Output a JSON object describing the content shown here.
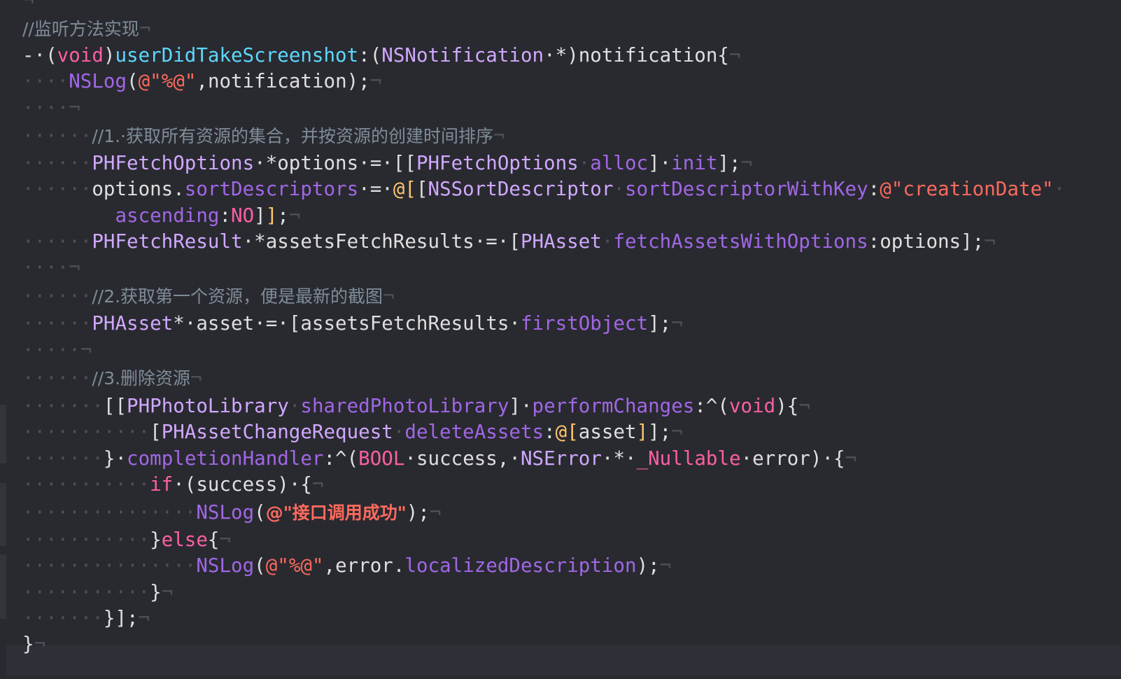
{
  "editor": {
    "lines": [
      {
        "tokens": [
          {
            "t": "¬",
            "c": "ws"
          }
        ]
      },
      {
        "tokens": [
          {
            "t": "//监听方法实现",
            "c": "comment"
          },
          {
            "t": "¬",
            "c": "ws"
          }
        ]
      },
      {
        "tokens": [
          {
            "t": "-·(",
            "c": "plain"
          },
          {
            "t": "void",
            "c": "keyword"
          },
          {
            "t": ")",
            "c": "plain"
          },
          {
            "t": "userDidTakeScreenshot",
            "c": "declname"
          },
          {
            "t": ":(",
            "c": "plain"
          },
          {
            "t": "NSNotification",
            "c": "class"
          },
          {
            "t": "·*)notification{",
            "c": "plain"
          },
          {
            "t": "¬",
            "c": "ws"
          }
        ]
      },
      {
        "tokens": [
          {
            "t": "····",
            "c": "ws"
          },
          {
            "t": "NSLog",
            "c": "method"
          },
          {
            "t": "(",
            "c": "plain"
          },
          {
            "t": "@\"%@\"",
            "c": "string"
          },
          {
            "t": ",notification);",
            "c": "plain"
          },
          {
            "t": "¬",
            "c": "ws"
          }
        ]
      },
      {
        "tokens": [
          {
            "t": "····¬",
            "c": "ws"
          }
        ]
      },
      {
        "tokens": [
          {
            "t": "······",
            "c": "ws"
          },
          {
            "t": "//1.·获取所有资源的集合，并按资源的创建时间排序",
            "c": "comment"
          },
          {
            "t": "¬",
            "c": "ws"
          }
        ]
      },
      {
        "tokens": [
          {
            "t": "······",
            "c": "ws"
          },
          {
            "t": "PHFetchOptions",
            "c": "class"
          },
          {
            "t": "·*options·=·[[",
            "c": "plain"
          },
          {
            "t": "PHFetchOptions",
            "c": "class"
          },
          {
            "t": "·",
            "c": "ws"
          },
          {
            "t": "alloc",
            "c": "method"
          },
          {
            "t": "]·",
            "c": "plain"
          },
          {
            "t": "init",
            "c": "method"
          },
          {
            "t": "];",
            "c": "plain"
          },
          {
            "t": "¬",
            "c": "ws"
          }
        ]
      },
      {
        "tokens": [
          {
            "t": "······",
            "c": "ws"
          },
          {
            "t": "options.",
            "c": "plain"
          },
          {
            "t": "sortDescriptors",
            "c": "method"
          },
          {
            "t": "·=·",
            "c": "plain"
          },
          {
            "t": "@[",
            "c": "gold"
          },
          {
            "t": "[",
            "c": "plain"
          },
          {
            "t": "NSSortDescriptor",
            "c": "class"
          },
          {
            "t": "·",
            "c": "ws"
          },
          {
            "t": "sortDescriptorWithKey",
            "c": "method"
          },
          {
            "t": ":",
            "c": "plain"
          },
          {
            "t": "@\"creationDate\"",
            "c": "string"
          },
          {
            "t": "·",
            "c": "ws"
          }
        ]
      },
      {
        "tokens": [
          {
            "t": "        ",
            "c": "ws"
          },
          {
            "t": "ascending",
            "c": "method"
          },
          {
            "t": ":",
            "c": "plain"
          },
          {
            "t": "NO",
            "c": "keyword"
          },
          {
            "t": "]",
            "c": "plain"
          },
          {
            "t": "]",
            "c": "gold"
          },
          {
            "t": ";",
            "c": "plain"
          },
          {
            "t": "¬",
            "c": "ws"
          }
        ]
      },
      {
        "tokens": [
          {
            "t": "······",
            "c": "ws"
          },
          {
            "t": "PHFetchResult",
            "c": "class"
          },
          {
            "t": "·*assetsFetchResults·=·[",
            "c": "plain"
          },
          {
            "t": "PHAsset",
            "c": "class"
          },
          {
            "t": "·",
            "c": "ws"
          },
          {
            "t": "fetchAssetsWithOptions",
            "c": "method"
          },
          {
            "t": ":options];",
            "c": "plain"
          },
          {
            "t": "¬",
            "c": "ws"
          }
        ]
      },
      {
        "tokens": [
          {
            "t": "····¬",
            "c": "ws"
          }
        ]
      },
      {
        "tokens": [
          {
            "t": "······",
            "c": "ws"
          },
          {
            "t": "//2.获取第一个资源，便是最新的截图",
            "c": "comment"
          },
          {
            "t": "¬",
            "c": "ws"
          }
        ]
      },
      {
        "tokens": [
          {
            "t": "······",
            "c": "ws"
          },
          {
            "t": "PHAsset",
            "c": "class"
          },
          {
            "t": "*·asset·=·[assetsFetchResults·",
            "c": "plain"
          },
          {
            "t": "firstObject",
            "c": "method"
          },
          {
            "t": "];",
            "c": "plain"
          },
          {
            "t": "¬",
            "c": "ws"
          }
        ]
      },
      {
        "tokens": [
          {
            "t": "·····¬",
            "c": "ws"
          }
        ]
      },
      {
        "tokens": [
          {
            "t": "······",
            "c": "ws"
          },
          {
            "t": "//3.删除资源",
            "c": "comment"
          },
          {
            "t": "¬",
            "c": "ws"
          }
        ]
      },
      {
        "tokens": [
          {
            "t": "·······",
            "c": "ws"
          },
          {
            "t": "[[",
            "c": "plain"
          },
          {
            "t": "PHPhotoLibrary",
            "c": "class"
          },
          {
            "t": "·",
            "c": "ws"
          },
          {
            "t": "sharedPhotoLibrary",
            "c": "method"
          },
          {
            "t": "]·",
            "c": "plain"
          },
          {
            "t": "performChanges",
            "c": "method"
          },
          {
            "t": ":^(",
            "c": "plain"
          },
          {
            "t": "void",
            "c": "keyword"
          },
          {
            "t": "){",
            "c": "plain"
          },
          {
            "t": "¬",
            "c": "ws"
          }
        ]
      },
      {
        "tokens": [
          {
            "t": "···········",
            "c": "ws"
          },
          {
            "t": "[",
            "c": "plain"
          },
          {
            "t": "PHAssetChangeRequest",
            "c": "class"
          },
          {
            "t": "·",
            "c": "ws"
          },
          {
            "t": "deleteAssets",
            "c": "method"
          },
          {
            "t": ":",
            "c": "plain"
          },
          {
            "t": "@[",
            "c": "gold"
          },
          {
            "t": "asset",
            "c": "plain"
          },
          {
            "t": "]",
            "c": "gold"
          },
          {
            "t": "];",
            "c": "plain"
          },
          {
            "t": "¬",
            "c": "ws"
          }
        ]
      },
      {
        "tokens": [
          {
            "t": "·······",
            "c": "ws"
          },
          {
            "t": "}·",
            "c": "plain"
          },
          {
            "t": "completionHandler",
            "c": "method"
          },
          {
            "t": ":^(",
            "c": "plain"
          },
          {
            "t": "BOOL",
            "c": "keyword"
          },
          {
            "t": "·success,·",
            "c": "plain"
          },
          {
            "t": "NSError",
            "c": "class"
          },
          {
            "t": "·*·",
            "c": "plain"
          },
          {
            "t": "_Nullable",
            "c": "keyword"
          },
          {
            "t": "·error)·{",
            "c": "plain"
          },
          {
            "t": "¬",
            "c": "ws"
          }
        ]
      },
      {
        "tokens": [
          {
            "t": "···········",
            "c": "ws"
          },
          {
            "t": "if",
            "c": "keyword"
          },
          {
            "t": "·(success)·{",
            "c": "plain"
          },
          {
            "t": "¬",
            "c": "ws"
          }
        ]
      },
      {
        "tokens": [
          {
            "t": "···············",
            "c": "ws"
          },
          {
            "t": "NSLog",
            "c": "method"
          },
          {
            "t": "(",
            "c": "plain"
          },
          {
            "t": "@\"接口调用成功\"",
            "c": "strbold"
          },
          {
            "t": ");",
            "c": "plain"
          },
          {
            "t": "¬",
            "c": "ws"
          }
        ]
      },
      {
        "tokens": [
          {
            "t": "···········",
            "c": "ws"
          },
          {
            "t": "}",
            "c": "plain"
          },
          {
            "t": "else",
            "c": "keyword"
          },
          {
            "t": "{",
            "c": "plain"
          },
          {
            "t": "¬",
            "c": "ws"
          }
        ]
      },
      {
        "tokens": [
          {
            "t": "···············",
            "c": "ws"
          },
          {
            "t": "NSLog",
            "c": "method"
          },
          {
            "t": "(",
            "c": "plain"
          },
          {
            "t": "@\"%@\"",
            "c": "string"
          },
          {
            "t": ",error.",
            "c": "plain"
          },
          {
            "t": "localizedDescription",
            "c": "method"
          },
          {
            "t": ");",
            "c": "plain"
          },
          {
            "t": "¬",
            "c": "ws"
          }
        ]
      },
      {
        "tokens": [
          {
            "t": "···········",
            "c": "ws"
          },
          {
            "t": "}",
            "c": "plain"
          },
          {
            "t": "¬",
            "c": "ws"
          }
        ]
      },
      {
        "tokens": [
          {
            "t": "·······",
            "c": "ws"
          },
          {
            "t": "}];",
            "c": "plain"
          },
          {
            "t": "¬",
            "c": "ws"
          }
        ]
      },
      {
        "tokens": [
          {
            "t": "}",
            "c": "plain"
          },
          {
            "t": "¬",
            "c": "ws"
          }
        ]
      }
    ]
  },
  "colors": {
    "background": "#292a30",
    "comment": "#7f8c98",
    "keyword": "#fc5fa3",
    "class": "#d0a8ff",
    "method": "#a167e6",
    "declaration": "#5dd8ff",
    "string": "#fc6a5d",
    "plain": "#dfdfe0",
    "invisibles": "#4e5058"
  }
}
